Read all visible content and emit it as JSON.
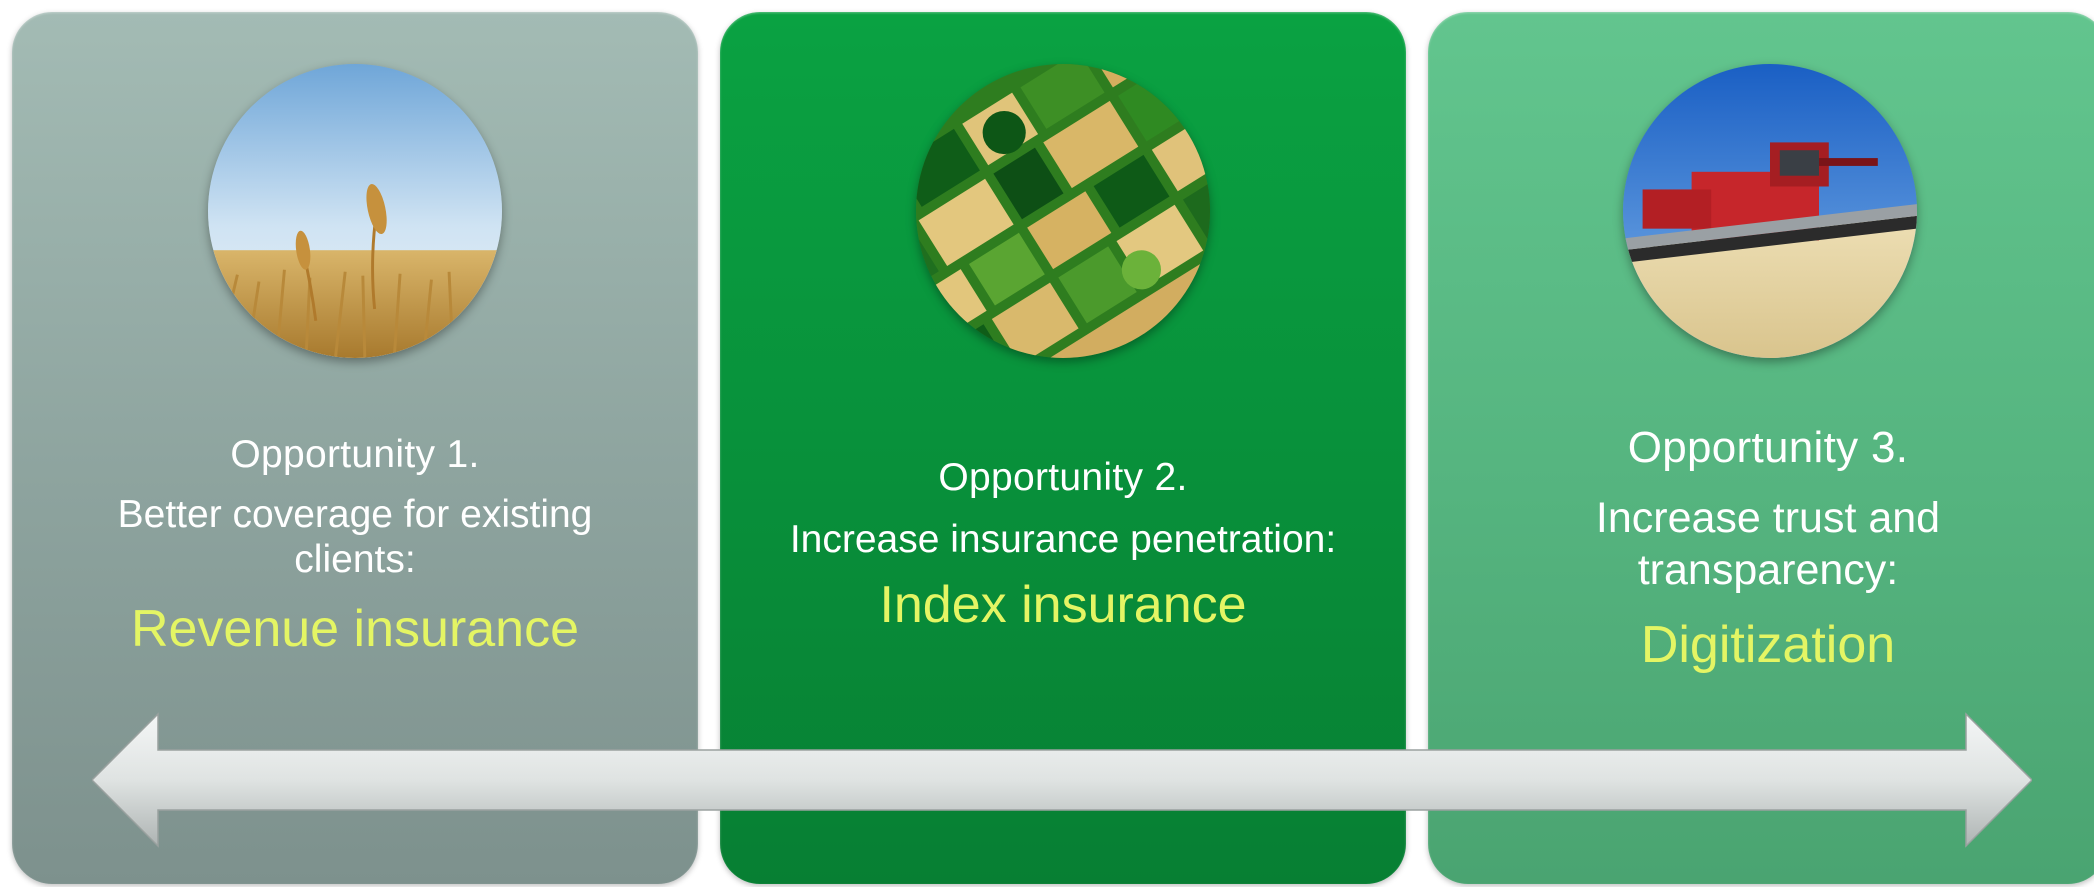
{
  "panels": [
    {
      "label": "Opportunity 1.",
      "description": "Better coverage for existing clients:",
      "highlight": "Revenue insurance",
      "photo_icon": "wheat-field-photo",
      "background": "#8da39e"
    },
    {
      "label": "Opportunity 2.",
      "description": "Increase insurance penetration:",
      "highlight": "Index insurance",
      "photo_icon": "aerial-farmland-photo",
      "background": "#088f3a"
    },
    {
      "label": "Opportunity 3.",
      "description": "Increase trust and transparency:",
      "highlight": "Digitization",
      "photo_icon": "combine-harvester-photo",
      "background": "#55b47f"
    }
  ],
  "colors": {
    "highlight_text": "#e4f564",
    "body_text": "#ffffff",
    "arrow": "#dfe3e2"
  },
  "arrow_icon": "double-headed-arrow-icon"
}
